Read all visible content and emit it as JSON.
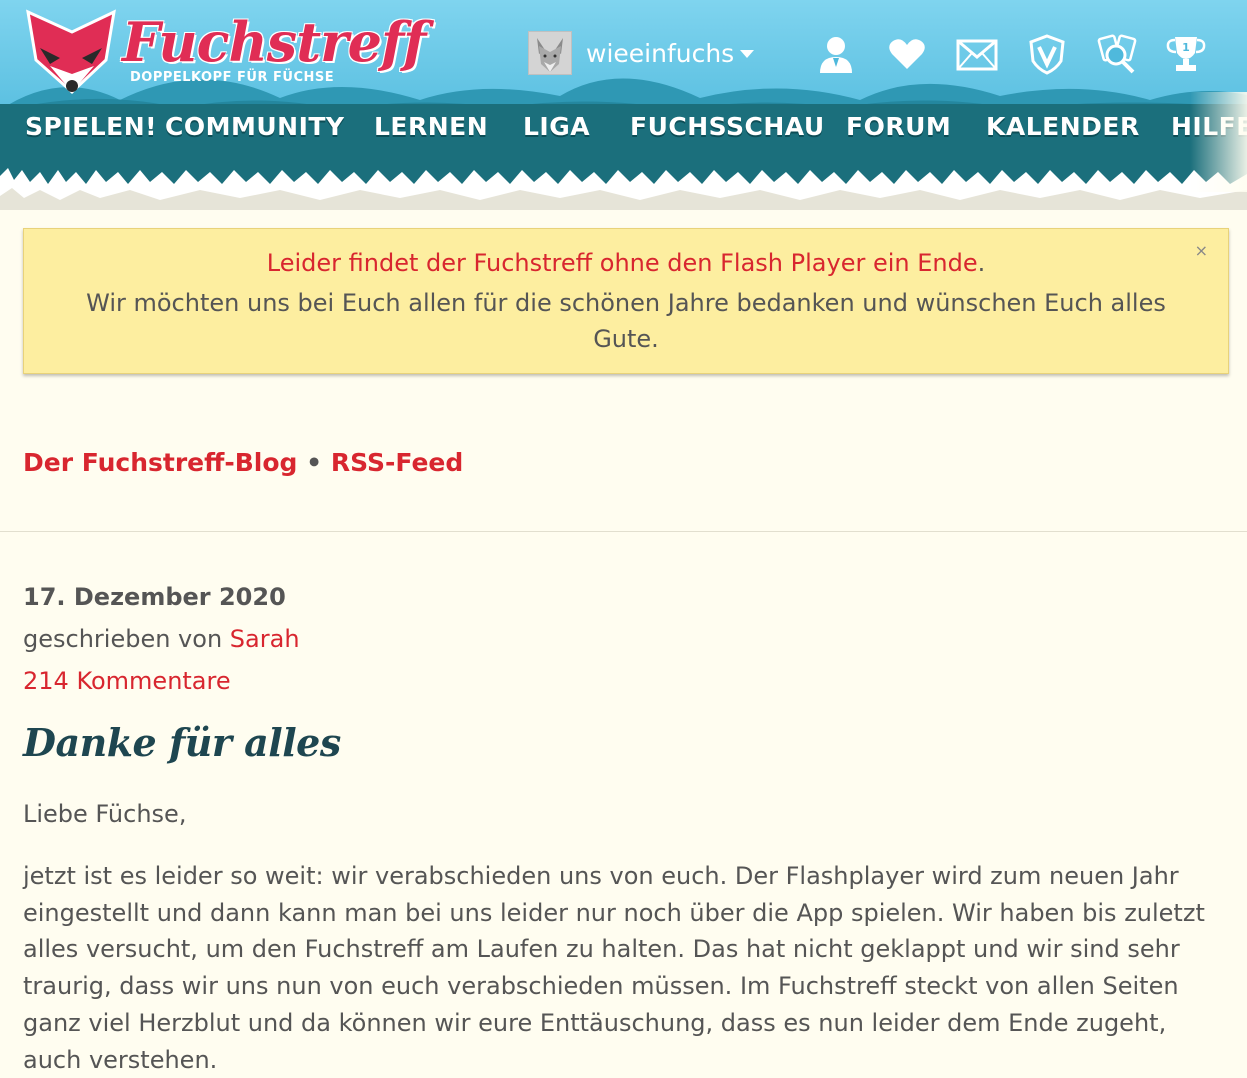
{
  "header": {
    "logo_title": "Fuchstreff",
    "logo_subtitle": "DOPPELKOPF FÜR FÜCHSE",
    "username": "wieeinfuchs",
    "icons": [
      "profile-icon",
      "heart-icon",
      "mail-icon",
      "v-badge-icon",
      "search-cards-icon",
      "trophy-icon"
    ]
  },
  "nav": {
    "items": [
      {
        "label": "SPIELEN!"
      },
      {
        "label": "COMMUNITY"
      },
      {
        "label": "LERNEN"
      },
      {
        "label": "LIGA"
      },
      {
        "label": "FUCHSSCHAU"
      },
      {
        "label": "FORUM"
      },
      {
        "label": "KALENDER"
      },
      {
        "label": "HILFE"
      }
    ]
  },
  "alert": {
    "highlight": "Leider findet der Fuchstreff ohne den Flash Player ein Ende",
    "period": ".",
    "message": "Wir möchten uns bei Euch allen für die schönen Jahre bedanken und wünschen Euch alles Gute.",
    "close_label": "×"
  },
  "blog_links": {
    "blog_label": "Der Fuchstreff-Blog",
    "separator": "•",
    "rss_label": "RSS-Feed"
  },
  "post": {
    "date": "17. Dezember 2020",
    "author_prefix": "geschrieben von",
    "author": "Sarah",
    "comments": "214 Kommentare",
    "title": "Danke für alles",
    "greeting": "Liebe Füchse,",
    "body": "jetzt ist es leider so weit: wir verabschieden uns von euch. Der Flashplayer wird zum neuen Jahr eingestellt und dann kann man bei uns leider nur noch über die App spielen. Wir haben bis zuletzt alles versucht, um den Fuchstreff am Laufen zu halten. Das hat nicht geklappt und wir sind sehr traurig, dass wir uns nun von euch verabschieden müssen. Im Fuchstreff steckt von allen Seiten ganz viel Herzblut und da können wir eure Enttäuschung, dass es nun leider dem Ende zugeht, auch verstehen."
  },
  "colors": {
    "accent_red": "#d8262f",
    "nav_teal": "#1b6f7c",
    "sky_blue": "#4fb9dc",
    "alert_yellow": "#fdeea0",
    "page_bg": "#fffdf0",
    "title_dark": "#1e4650"
  }
}
